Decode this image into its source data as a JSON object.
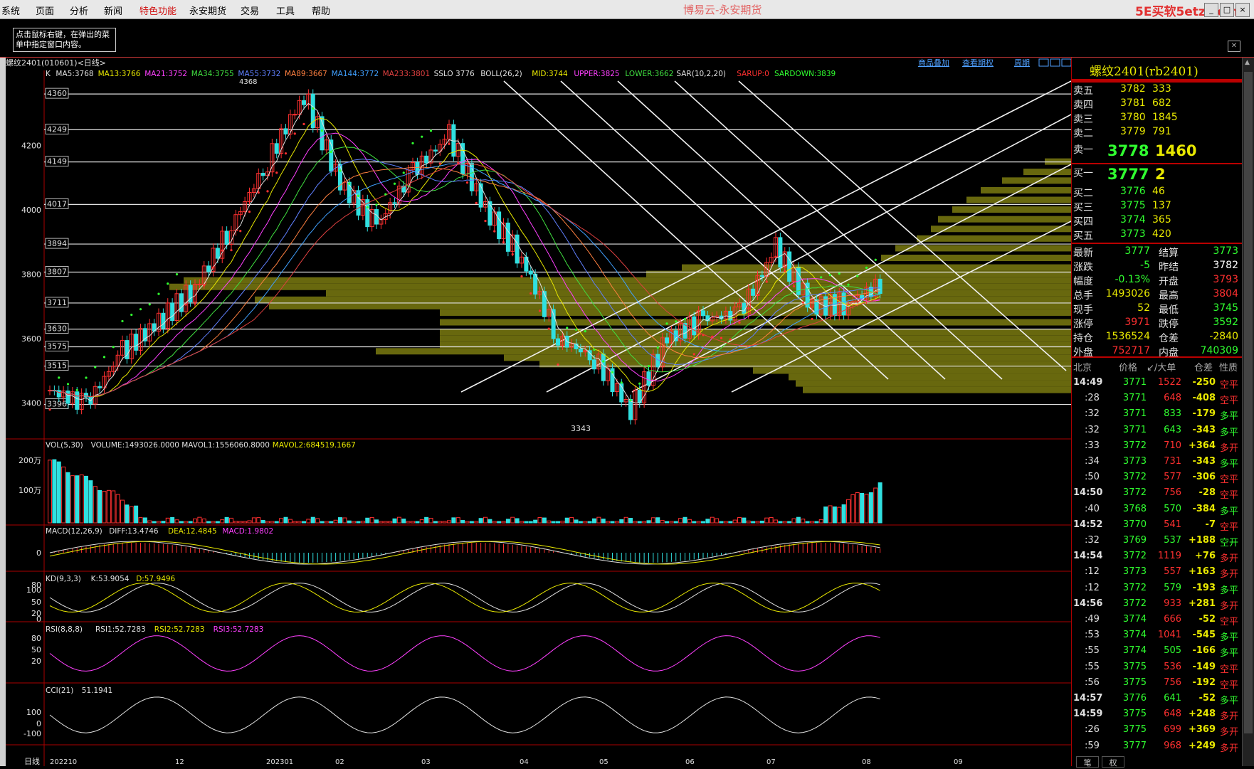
{
  "menubar": {
    "items": [
      "系统",
      "页面",
      "分析",
      "新闻",
      "特色功能",
      "永安期货",
      "交易",
      "工具",
      "帮助"
    ],
    "highlight_index": 4,
    "app_title": "博易云-永安期货",
    "site_logo": "5E买软5etz.com",
    "window_buttons": [
      "_",
      "□",
      "×"
    ]
  },
  "tip_text": "点击鼠标右键，在弹出的菜单中指定窗口内容。",
  "chart_header": {
    "instrument": "螺纹2401(010601)<日线>",
    "links": [
      "商品叠加",
      "查看期权",
      "周期"
    ]
  },
  "ma_legend": [
    {
      "text": "K",
      "color": "#e0e0e0"
    },
    {
      "text": "MA5:3768",
      "color": "#e0e0e0"
    },
    {
      "text": "MA13:3766",
      "color": "#e8e800"
    },
    {
      "text": "MA21:3752",
      "color": "#ff40ff"
    },
    {
      "text": "MA34:3755",
      "color": "#40e040"
    },
    {
      "text": "MA55:3732",
      "color": "#6080ff"
    },
    {
      "text": "MA89:3667",
      "color": "#ff8040"
    },
    {
      "text": "MA144:3772",
      "color": "#40a0ff"
    },
    {
      "text": "MA233:3801",
      "color": "#e04040"
    },
    {
      "text": "SSLO 3776",
      "color": "#e0e0e0"
    },
    {
      "text": "BOLL(26,2)",
      "color": "#e0e0e0"
    },
    {
      "text": "MID:3744",
      "color": "#e8e800"
    },
    {
      "text": "UPPER:3825",
      "color": "#ff40ff"
    },
    {
      "text": "LOWER:3662",
      "color": "#40e040"
    },
    {
      "text": "SAR(10,2,20)",
      "color": "#e0e0e0"
    },
    {
      "text": "SARUP:0",
      "color": "#ff3030"
    },
    {
      "text": "SARDOWN:3839",
      "color": "#30ff30"
    }
  ],
  "price_axis": {
    "labels": [
      "4200",
      "4000",
      "3800",
      "3600",
      "3400"
    ],
    "values": [
      4200,
      4000,
      3800,
      3600,
      3400
    ]
  },
  "level_labels": [
    "4360",
    "4249",
    "4149",
    "4017",
    "3894",
    "3807",
    "3711",
    "3630",
    "3575",
    "3515",
    "3396"
  ],
  "level_values": [
    4360,
    4249,
    4149,
    4017,
    3894,
    3807,
    3711,
    3630,
    3575,
    3515,
    3396
  ],
  "high_label": "4368",
  "low_label": "3343",
  "volume_panel": {
    "legend": [
      {
        "text": "VOL(5,30)",
        "color": "#e0e0e0"
      },
      {
        "text": "VOLUME:1493026.0000",
        "color": "#e0e0e0"
      },
      {
        "text": "MAVOL1:1556060.8000",
        "color": "#e0e0e0"
      },
      {
        "text": "MAVOL2:684519.1667",
        "color": "#e8e800"
      }
    ],
    "axis": [
      "200万",
      "100万"
    ]
  },
  "macd_panel": {
    "legend": [
      {
        "text": "MACD(12,26,9)",
        "color": "#e0e0e0"
      },
      {
        "text": "DIFF:13.4746",
        "color": "#e0e0e0"
      },
      {
        "text": "DEA:12.4845",
        "color": "#e8e800"
      },
      {
        "text": "MACD:1.9802",
        "color": "#ff40ff"
      }
    ],
    "axis": [
      "0"
    ]
  },
  "kd_panel": {
    "legend": [
      {
        "text": "KD(9,3,3)",
        "color": "#e0e0e0"
      },
      {
        "text": "K:53.9054",
        "color": "#e0e0e0"
      },
      {
        "text": "D:57.9496",
        "color": "#e8e800"
      }
    ],
    "axis": [
      "80",
      "100",
      "50",
      "20",
      "0"
    ]
  },
  "rsi_panel": {
    "legend": [
      {
        "text": "RSI(8,8,8)",
        "color": "#e0e0e0"
      },
      {
        "text": "RSI1:52.7283",
        "color": "#e0e0e0"
      },
      {
        "text": "RSI2:52.7283",
        "color": "#e8e800"
      },
      {
        "text": "RSI3:52.7283",
        "color": "#ff40ff"
      }
    ],
    "axis": [
      "80",
      "50",
      "20"
    ]
  },
  "cci_panel": {
    "legend": [
      {
        "text": "CCI(21)",
        "color": "#e0e0e0"
      },
      {
        "text": "51.1941",
        "color": "#e0e0e0"
      }
    ],
    "axis": [
      "100",
      "0",
      "-100"
    ]
  },
  "date_axis": {
    "title": "日线",
    "labels": [
      "202210",
      "12",
      "202301",
      "02",
      "03",
      "04",
      "05",
      "06",
      "07",
      "08",
      "09"
    ]
  },
  "right_panel": {
    "title": "螺纹2401(rb2401)",
    "asks": [
      {
        "label": "卖五",
        "price": "3782",
        "vol": "333"
      },
      {
        "label": "卖四",
        "price": "3781",
        "vol": "682"
      },
      {
        "label": "卖三",
        "price": "3780",
        "vol": "1845"
      },
      {
        "label": "卖二",
        "price": "3779",
        "vol": "791"
      },
      {
        "label": "卖一",
        "price": "3778",
        "vol": "1460"
      }
    ],
    "bids": [
      {
        "label": "买一",
        "price": "3777",
        "vol": "2"
      },
      {
        "label": "买二",
        "price": "3776",
        "vol": "46"
      },
      {
        "label": "买三",
        "price": "3775",
        "vol": "137"
      },
      {
        "label": "买四",
        "price": "3774",
        "vol": "365"
      },
      {
        "label": "买五",
        "price": "3773",
        "vol": "420"
      }
    ],
    "quotes": [
      {
        "l1": "最新",
        "v1": "3777",
        "c1": "#30ff30",
        "l2": "结算",
        "v2": "3773",
        "c2": "#30ff30"
      },
      {
        "l1": "涨跌",
        "v1": "-5",
        "c1": "#30ff30",
        "l2": "昨结",
        "v2": "3782",
        "c2": "#ffffff"
      },
      {
        "l1": "幅度",
        "v1": "-0.13%",
        "c1": "#30ff30",
        "l2": "开盘",
        "v2": "3793",
        "c2": "#ff3030"
      },
      {
        "l1": "总手",
        "v1": "1493026",
        "c1": "#e8e800",
        "l2": "最高",
        "v2": "3804",
        "c2": "#ff3030"
      },
      {
        "l1": "现手",
        "v1": "52",
        "c1": "#e8e800",
        "l2": "最低",
        "v2": "3745",
        "c2": "#30ff30"
      },
      {
        "l1": "涨停",
        "v1": "3971",
        "c1": "#ff3030",
        "l2": "跌停",
        "v2": "3592",
        "c2": "#30ff30"
      },
      {
        "l1": "持仓",
        "v1": "1536524",
        "c1": "#e8e800",
        "l2": "仓差",
        "v2": "-2840",
        "c2": "#e8e800"
      },
      {
        "l1": "外盘",
        "v1": "752717",
        "c1": "#ff3030",
        "l2": "内盘",
        "v2": "740309",
        "c2": "#30ff30"
      }
    ],
    "ticks_header": [
      "北京",
      "价格",
      "↙/大单",
      "仓差",
      "性质"
    ],
    "ticks": [
      {
        "t": "14:49",
        "p": "3771",
        "v": "1522",
        "d": "-250",
        "n": "空平",
        "vc": "#ff3030",
        "nc": "#ff3030",
        "major": true
      },
      {
        "t": ":28",
        "p": "3771",
        "v": "648",
        "d": "-408",
        "n": "空平",
        "vc": "#ff3030",
        "nc": "#ff3030",
        "major": false
      },
      {
        "t": ":32",
        "p": "3771",
        "v": "833",
        "d": "-179",
        "n": "多平",
        "vc": "#30ff30",
        "nc": "#30ff30",
        "major": false
      },
      {
        "t": ":32",
        "p": "3771",
        "v": "643",
        "d": "-343",
        "n": "多平",
        "vc": "#30ff30",
        "nc": "#30ff30",
        "major": false
      },
      {
        "t": ":33",
        "p": "3772",
        "v": "710",
        "d": "+364",
        "n": "多开",
        "vc": "#ff3030",
        "nc": "#ff3030",
        "major": false
      },
      {
        "t": ":34",
        "p": "3773",
        "v": "731",
        "d": "-343",
        "n": "多平",
        "vc": "#ff3030",
        "nc": "#30ff30",
        "major": false
      },
      {
        "t": ":50",
        "p": "3772",
        "v": "577",
        "d": "-306",
        "n": "空平",
        "vc": "#ff3030",
        "nc": "#ff3030",
        "major": false
      },
      {
        "t": "14:50",
        "p": "3772",
        "v": "756",
        "d": "-28",
        "n": "空平",
        "vc": "#ff3030",
        "nc": "#ff3030",
        "major": true
      },
      {
        "t": ":40",
        "p": "3768",
        "v": "570",
        "d": "-384",
        "n": "多平",
        "vc": "#30ff30",
        "nc": "#30ff30",
        "major": false
      },
      {
        "t": "14:52",
        "p": "3770",
        "v": "541",
        "d": "-7",
        "n": "空平",
        "vc": "#ff3030",
        "nc": "#ff3030",
        "major": true
      },
      {
        "t": ":32",
        "p": "3769",
        "v": "537",
        "d": "+188",
        "n": "空开",
        "vc": "#30ff30",
        "nc": "#30ff30",
        "major": false
      },
      {
        "t": "14:54",
        "p": "3772",
        "v": "1119",
        "d": "+76",
        "n": "多开",
        "vc": "#ff3030",
        "nc": "#ff3030",
        "major": true
      },
      {
        "t": ":12",
        "p": "3773",
        "v": "557",
        "d": "+163",
        "n": "多开",
        "vc": "#ff3030",
        "nc": "#ff3030",
        "major": false
      },
      {
        "t": ":12",
        "p": "3772",
        "v": "579",
        "d": "-193",
        "n": "多平",
        "vc": "#30ff30",
        "nc": "#30ff30",
        "major": false
      },
      {
        "t": "14:56",
        "p": "3772",
        "v": "933",
        "d": "+281",
        "n": "多开",
        "vc": "#ff3030",
        "nc": "#ff3030",
        "major": true
      },
      {
        "t": ":49",
        "p": "3774",
        "v": "666",
        "d": "-52",
        "n": "空平",
        "vc": "#ff3030",
        "nc": "#ff3030",
        "major": false
      },
      {
        "t": ":53",
        "p": "3774",
        "v": "1041",
        "d": "-545",
        "n": "多平",
        "vc": "#ff3030",
        "nc": "#30ff30",
        "major": false
      },
      {
        "t": ":55",
        "p": "3774",
        "v": "505",
        "d": "-166",
        "n": "多平",
        "vc": "#30ff30",
        "nc": "#30ff30",
        "major": false
      },
      {
        "t": ":55",
        "p": "3775",
        "v": "536",
        "d": "-149",
        "n": "空平",
        "vc": "#ff3030",
        "nc": "#ff3030",
        "major": false
      },
      {
        "t": ":56",
        "p": "3775",
        "v": "756",
        "d": "-192",
        "n": "空平",
        "vc": "#ff3030",
        "nc": "#ff3030",
        "major": false
      },
      {
        "t": "14:57",
        "p": "3776",
        "v": "641",
        "d": "-52",
        "n": "多平",
        "vc": "#30ff30",
        "nc": "#30ff30",
        "major": true
      },
      {
        "t": "14:59",
        "p": "3775",
        "v": "648",
        "d": "+248",
        "n": "多开",
        "vc": "#ff3030",
        "nc": "#ff3030",
        "major": true
      },
      {
        "t": ":26",
        "p": "3775",
        "v": "699",
        "d": "+369",
        "n": "多开",
        "vc": "#ff3030",
        "nc": "#ff3030",
        "major": false
      },
      {
        "t": ":59",
        "p": "3777",
        "v": "968",
        "d": "+249",
        "n": "多开",
        "vc": "#ff3030",
        "nc": "#ff3030",
        "major": false
      }
    ],
    "bottom_tabs": [
      "笔",
      "权"
    ]
  },
  "chart_data": {
    "type": "candlestick",
    "title": "螺纹2401(010601)<日线>",
    "x_labels": [
      "202210",
      "12",
      "202301",
      "02",
      "03",
      "04",
      "05",
      "06",
      "07",
      "08",
      "09"
    ],
    "ylim": [
      3300,
      4400
    ],
    "close_points": [
      {
        "x": "202210",
        "y": 3440
      },
      {
        "x": "10b",
        "y": 3396
      },
      {
        "x": "11a",
        "y": 3560
      },
      {
        "x": "11b",
        "y": 3650
      },
      {
        "x": "12a",
        "y": 3760
      },
      {
        "x": "12b",
        "y": 3950
      },
      {
        "x": "202301a",
        "y": 4150
      },
      {
        "x": "202301b",
        "y": 4360
      },
      {
        "x": "02a",
        "y": 4080
      },
      {
        "x": "02b",
        "y": 3950
      },
      {
        "x": "03a",
        "y": 4120
      },
      {
        "x": "03b",
        "y": 4230
      },
      {
        "x": "04a",
        "y": 4000
      },
      {
        "x": "04b",
        "y": 3850
      },
      {
        "x": "05a",
        "y": 3600
      },
      {
        "x": "05b",
        "y": 3540
      },
      {
        "x": "06a",
        "y": 3380
      },
      {
        "x": "06b",
        "y": 3600
      },
      {
        "x": "07a",
        "y": 3660
      },
      {
        "x": "07b",
        "y": 3680
      },
      {
        "x": "08a",
        "y": 3880
      },
      {
        "x": "08b",
        "y": 3700
      },
      {
        "x": "09a",
        "y": 3710
      },
      {
        "x": "09b",
        "y": 3777
      }
    ],
    "volume_scale": [
      "200万",
      "100万"
    ],
    "legend": [
      "MA5",
      "MA13",
      "MA21",
      "MA34",
      "MA55",
      "MA89",
      "MA144",
      "MA233",
      "BOLL"
    ]
  }
}
